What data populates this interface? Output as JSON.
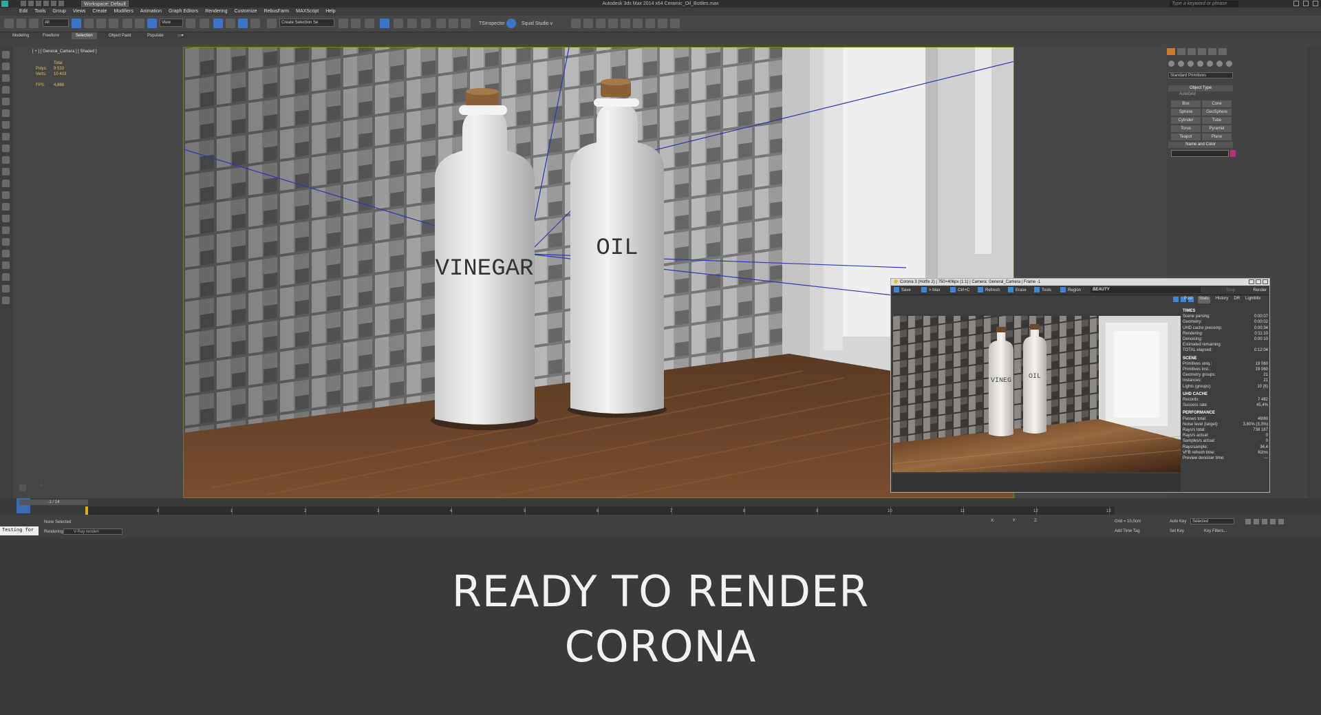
{
  "window": {
    "title": "Autodesk 3ds Max 2014 x64    Ceramic_Oil_Bottles.max",
    "workspace": "Workspace: Default",
    "search_placeholder": "Type a keyword or phrase"
  },
  "menu": [
    "Edit",
    "Tools",
    "Group",
    "Views",
    "Create",
    "Modifiers",
    "Animation",
    "Graph Editors",
    "Rendering",
    "Customize",
    "RebusFarm",
    "MAXScript",
    "Help"
  ],
  "toolbar": {
    "filter": "All",
    "ref_coord": "View",
    "selection_set": "Create Selection Se",
    "ts_label": "TSInspector",
    "squid_label": "Squid Studio v"
  },
  "ribbon_tabs": [
    "Modeling",
    "Freeform",
    "Selection",
    "Object Paint",
    "Populate"
  ],
  "ribbon_active": "Selection",
  "viewport": {
    "label": "[ + ] [ General_Camera ] [ Shaded ]",
    "stats": {
      "total_label": "Total",
      "polys_label": "Polys:",
      "polys_value": "9 533",
      "verts_label": "Verts:",
      "verts_value": "10 403",
      "fps_label": "FPS:",
      "fps_value": "4,888"
    },
    "bottle_left_text": "VINEGAR",
    "bottle_right_text": "OIL"
  },
  "command_panel": {
    "dropdown": "Standard Primitives",
    "object_type_rollout": "Object Type",
    "autogrid": "AutoGrid",
    "buttons": [
      "Box",
      "Cone",
      "Sphere",
      "GeoSphere",
      "Cylinder",
      "Tube",
      "Torus",
      "Pyramid",
      "Teapot",
      "Plane"
    ],
    "name_color_rollout": "Name and Color",
    "swatch_color": "#c02a7a"
  },
  "vfb": {
    "title": "Corona 3 (Hotfix 2) | 750×406px (1:1) | Camera: General_Camera | Frame -1",
    "buttons": {
      "save": "Save",
      "max": "> Max",
      "ctrlc": "Ctrl+C",
      "refresh": "Refresh",
      "erase": "Erase",
      "tools": "Tools",
      "region": "Region",
      "stop": "Stop",
      "render": "Render"
    },
    "channel": "BEAUTY",
    "tabs": [
      "Post",
      "Stats",
      "History",
      "DR",
      "LightMix"
    ],
    "active_tab": "Stats",
    "image_text_left": "VINEG",
    "image_text_right": "OIL",
    "stats": {
      "times_header": "TIMES",
      "times": [
        {
          "label": "Scene parsing:",
          "value": "0:00:07"
        },
        {
          "label": "Geometry:",
          "value": "0:00:02"
        },
        {
          "label": "UHD cache precomp:",
          "value": "0:00:34"
        },
        {
          "label": "Rendering:",
          "value": "0:11:10"
        },
        {
          "label": "Denoising:",
          "value": "0:00:10"
        },
        {
          "label": "Estimated remaining:",
          "value": ""
        },
        {
          "label": "TOTAL elapsed:",
          "value": "0:12:04"
        }
      ],
      "scene_header": "SCENE",
      "scene": [
        {
          "label": "Primitives uniq.:",
          "value": "19 060"
        },
        {
          "label": "Primitives inst.:",
          "value": "19 060"
        },
        {
          "label": "Geometry groups:",
          "value": "21"
        },
        {
          "label": "Instances:",
          "value": "21"
        },
        {
          "label": "Lights (groups):",
          "value": "10 (6)"
        }
      ],
      "uhd_header": "UHD CACHE",
      "uhd": [
        {
          "label": "Records:",
          "value": "7 482"
        },
        {
          "label": "Success rate:",
          "value": "45,4%"
        }
      ],
      "perf_header": "PERFORMANCE",
      "perf": [
        {
          "label": "Passes total:",
          "value": "49/80"
        },
        {
          "label": "Noise level (target):",
          "value": "3,80% (3,3%)"
        },
        {
          "label": "Rays/s total:",
          "value": "738 187"
        },
        {
          "label": "Rays/s actual:",
          "value": "0"
        },
        {
          "label": "Samples/s actual:",
          "value": "0"
        },
        {
          "label": "Rays/sample:",
          "value": "34,4"
        },
        {
          "label": "VFB refresh time:",
          "value": "62ms"
        },
        {
          "label": "Preview denoiser time:",
          "value": "---"
        }
      ]
    }
  },
  "timeline": {
    "slider_label": "-1 / 14",
    "ticks": [
      "0",
      "1",
      "2",
      "3",
      "4",
      "5",
      "6",
      "7",
      "8",
      "9",
      "10",
      "11",
      "12",
      "13"
    ]
  },
  "status": {
    "maxscript": "Testing for",
    "selection": "None Selected",
    "rendering_label": "Rendering",
    "renderer": "V-Ray renderi",
    "x_label": "X:",
    "y_label": "Y:",
    "z_label": "Z:",
    "grid": "Grid = 10,0cm",
    "add_time_tag": "Add Time Tag",
    "auto_key": "Auto Key",
    "selected": "Selected",
    "set_key": "Set Key",
    "key_filters": "Key Filters..."
  },
  "caption": {
    "line1": "READY TO RENDER",
    "line2": "CORONA"
  }
}
